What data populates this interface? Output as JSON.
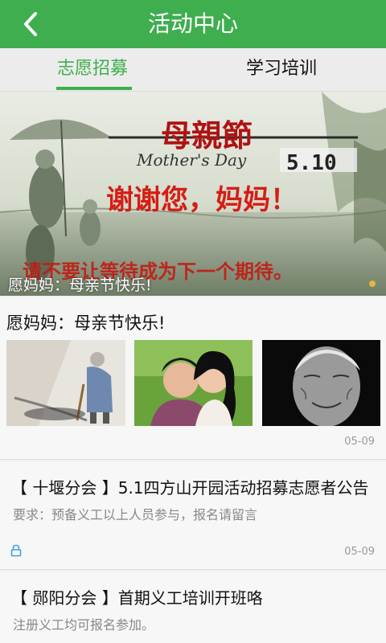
{
  "header": {
    "title": "活动中心",
    "back_icon": "chevron-left-icon"
  },
  "tabs": [
    {
      "label": "志愿招募",
      "active": true
    },
    {
      "label": "学习培训",
      "active": false
    }
  ],
  "banner": {
    "caption": "愿妈妈：母亲节快乐!",
    "artwork_text": {
      "headline": "母親節",
      "script": "Mother's Day",
      "date": "5.10",
      "thanks": "谢谢您，妈妈！",
      "bottom_line": "请不要让等待成为下一个期待。"
    }
  },
  "feed": [
    {
      "title": "愿妈妈：母亲节快乐!",
      "thumbnails": 3,
      "date": "05-09"
    },
    {
      "title": "【 十堰分会 】5.1四方山开园活动招募志愿者公告",
      "desc": "要求：预备义工以上人员参与，报名请留言",
      "date": "05-09",
      "icon": "lock-icon"
    },
    {
      "title": "【 郧阳分会 】首期义工培训开班咯",
      "desc": "注册义工均可报名参加。"
    }
  ],
  "colors": {
    "brand": "#3fae4f",
    "text": "#111111",
    "muted": "#888888"
  }
}
